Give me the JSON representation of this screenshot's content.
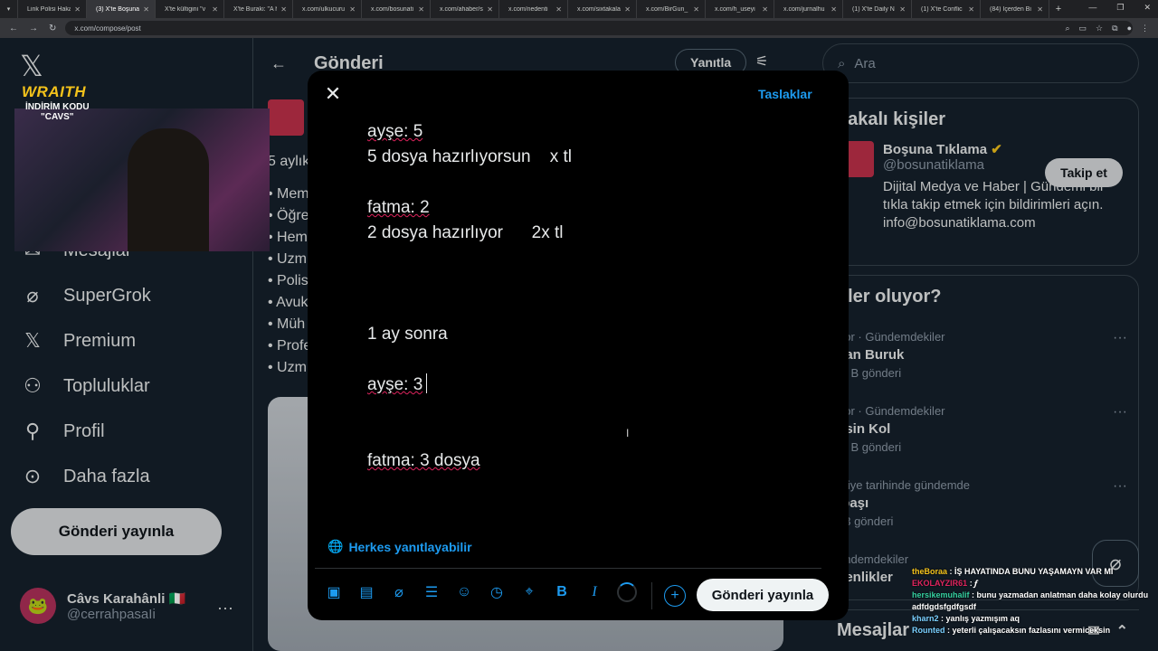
{
  "browser": {
    "tabs": [
      {
        "label": "Link Polisi Haka"
      },
      {
        "label": "(3) X'te Boşuna",
        "active": true
      },
      {
        "label": "X'te kültigini \"v"
      },
      {
        "label": "X'te Buraki: \"A h"
      },
      {
        "label": "x.com/ulkucuru"
      },
      {
        "label": "x.com/bosunati"
      },
      {
        "label": "x.com/ahaber/s"
      },
      {
        "label": "x.com/nedenti"
      },
      {
        "label": "x.com/sixtakala"
      },
      {
        "label": "x.com/BirGun_"
      },
      {
        "label": "x.com/h_useyi"
      },
      {
        "label": "x.com/jurnalhu"
      },
      {
        "label": "(1) X'te Daily N"
      },
      {
        "label": "(1) X'te Conflic"
      },
      {
        "label": "(84) İçerden Bi"
      }
    ],
    "url": "x.com/compose/post"
  },
  "sidebar": {
    "items": [
      {
        "label": "Mesajlar",
        "icon": "mail-icon"
      },
      {
        "label": "SuperGrok",
        "icon": "grok-icon"
      },
      {
        "label": "Premium",
        "icon": "x-premium-icon"
      },
      {
        "label": "Topluluklar",
        "icon": "communities-icon"
      },
      {
        "label": "Profil",
        "icon": "profile-icon"
      },
      {
        "label": "Daha fazla",
        "icon": "more-icon"
      }
    ],
    "post_button": "Gönderi yayınla",
    "account": {
      "name": "Câvs Karahânli 🇮🇹",
      "handle": "@cerrahpasaIi"
    }
  },
  "center": {
    "title": "Gönderi",
    "reply_button": "Yanıtla",
    "bg_time": "5 aylık",
    "bg_lines": [
      "• Mem",
      "• Öğre",
      "• Hem",
      "• Uzm",
      "• Polis",
      "• Avuk",
      "• Müh",
      "• Profe",
      "• Uzm"
    ]
  },
  "right": {
    "search_placeholder": "Ara",
    "who_title": "İlakalı kişiler",
    "who": {
      "name": "Boşuna Tıklama",
      "handle": "@bosunatiklama",
      "bio": "Dijital Medya ve Haber | Gündemi bir tıkla takip etmek için bildirimleri açın. info@bosunatiklama.com",
      "follow": "Takip et"
    },
    "trends_title": "eler oluyor?",
    "trends": [
      {
        "meta": "por · Gündemdekiler",
        "name": "kan Buruk",
        "count": ",2 B gönderi"
      },
      {
        "meta": "por · Gündemdekiler",
        "name": "asin Kol",
        "count": ",8 B gönderi"
      },
      {
        "meta": "rkiye tarihinde gündemde",
        "name": "lbaşı",
        "count": "83 gönderi"
      },
      {
        "meta": "ündemdekiler",
        "name": "senlikler",
        "count": ""
      }
    ],
    "messages": "Mesajlar"
  },
  "modal": {
    "drafts": "Taslaklar",
    "lines": [
      "ayşe: 5",
      "5 dosya hazırlıyorsun    x tl",
      "",
      "fatma: 2",
      "2 dosya hazırlıyor      2x tl",
      "",
      "",
      "",
      "1 ay sonra",
      "",
      "ayşe: 3",
      "",
      "",
      "fatma: 3 dosya"
    ],
    "reply_setting": "Herkes yanıtlayabilir",
    "publish": "Gönderi yayınla"
  },
  "stream": {
    "brand": "WRAITH",
    "promo_line1": "İNDİRİM KODU",
    "promo_line2": "\"CAVS\"",
    "chat": [
      {
        "user": "theBoraa",
        "msg": "İŞ HAYATINDA BUNU YAŞAMAYN VAR MI"
      },
      {
        "user": "EKOLAYZIR61",
        "msg": "𝆑"
      },
      {
        "user": "hersikemuhalif",
        "msg": "bunu yazmadan anlatman daha kolay olurdu adfdgdsfgdfgsdf"
      },
      {
        "user": "kharn2",
        "msg": "yanlış yazmışım aq"
      },
      {
        "user": "Rounted",
        "msg": "yeterli çalışacaksın fazlasını vermiceksin"
      }
    ]
  },
  "colors": {
    "accent": "#1d9bf0",
    "bg": "#15202b",
    "modal_bg": "#000000"
  }
}
